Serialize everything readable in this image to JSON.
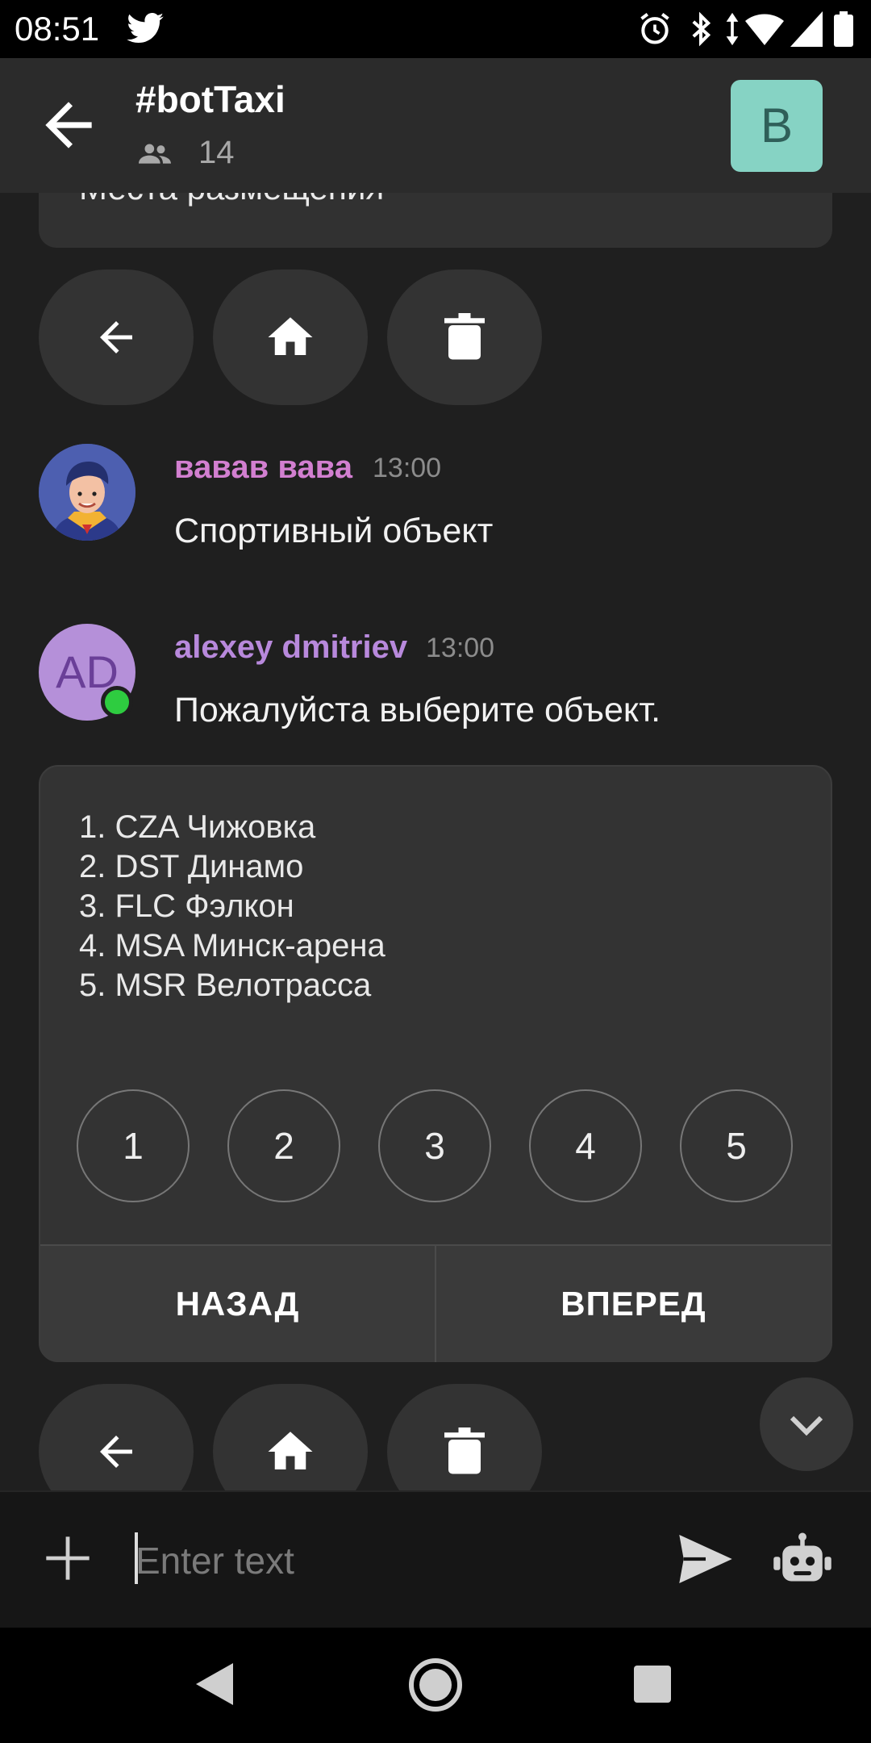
{
  "status_bar": {
    "time": "08:51",
    "icons": [
      "twitter-icon",
      "alarm-icon",
      "bluetooth-icon",
      "data-arrows-icon",
      "wifi-icon",
      "signal-icon",
      "battery-icon"
    ]
  },
  "header": {
    "title": "#botTaxi",
    "members_count": "14",
    "bot_avatar_letter": "B"
  },
  "previous_card_text": "Места размещения",
  "action_buttons": [
    "back-arrow-icon",
    "home-icon",
    "trash-icon"
  ],
  "messages": [
    {
      "sender": "вавав вава",
      "time": "13:00",
      "text": "Спортивный объект",
      "name_color": "#d27fd0"
    },
    {
      "sender": "alexey dmitriev",
      "time": "13:00",
      "text": "Пожалуйста выберите объект.",
      "initials": "AD",
      "name_color": "#b889dc"
    }
  ],
  "list_card": {
    "items": [
      "1. CZA Чижовка",
      "2. DST Динамо",
      "3. FLC Фэлкон",
      "4. MSA Минск-арена",
      "5. MSR Велотрасса"
    ],
    "number_buttons": [
      "1",
      "2",
      "3",
      "4",
      "5"
    ],
    "back_label": "НАЗАД",
    "forward_label": "ВПЕРЕД"
  },
  "composer": {
    "placeholder": "Enter text"
  },
  "colors": {
    "bot_avatar_bg": "#86d3c4",
    "online_dot": "#2ecc40",
    "initials_avatar_bg": "#b590d9"
  }
}
